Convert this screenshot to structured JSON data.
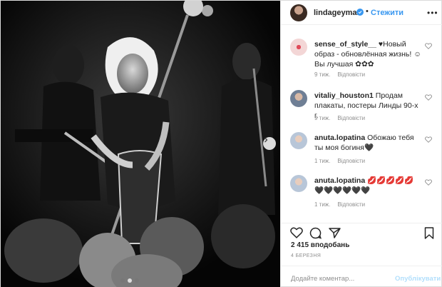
{
  "header": {
    "username": "lindageyman",
    "separator": "•",
    "follow_label": "Стежити"
  },
  "comments": [
    {
      "username": "sense_of_style__",
      "text": "♥Новый образ - обновлённая жизнь! ☺ Вы лучшая ✿✿✿",
      "age": "9 тиж.",
      "reply": "Відповісти"
    },
    {
      "username": "vitaliy_houston1",
      "text": "Продам плакаты, постеры Линды 90-х г.",
      "age": "9 тиж.",
      "reply": "Відповісти"
    },
    {
      "username": "anuta.lopatina",
      "text": "Обожаю тебя ты моя богиня🖤",
      "age": "1 тиж.",
      "reply": "Відповісти"
    },
    {
      "username": "anuta.lopatina",
      "text": "💋💋💋💋💋🖤🖤🖤🖤🖤🖤",
      "age": "1 тиж.",
      "reply": "Відповісти"
    }
  ],
  "likes": "2 415 вподобань",
  "date": "4 БЕРЕЗНЯ",
  "comment_input": {
    "placeholder": "Додайте коментар...",
    "post_label": "Опублікувати"
  },
  "icons": [
    "verified-icon",
    "more-icon",
    "heart-icon",
    "comment-icon",
    "share-icon",
    "bookmark-icon",
    "chevron-right-icon"
  ],
  "colors": {
    "accent": "#3897f0",
    "post_disabled": "#b2dffc",
    "muted": "#8e8e8e"
  },
  "carousel": {
    "slides": 3,
    "active_index": 1
  }
}
